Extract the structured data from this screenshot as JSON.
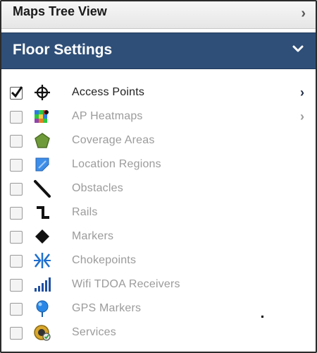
{
  "maps_tree": {
    "title": "Maps Tree View",
    "chevron": "›"
  },
  "floor_settings": {
    "title": "Floor Settings"
  },
  "layers": [
    {
      "label": "Access Points",
      "checked": true,
      "icon": "access-point-icon",
      "has_submenu": true,
      "submenu_active": true
    },
    {
      "label": "AP Heatmaps",
      "checked": false,
      "icon": "heatmap-icon",
      "has_submenu": true,
      "submenu_active": false
    },
    {
      "label": "Coverage Areas",
      "checked": false,
      "icon": "coverage-area-icon",
      "has_submenu": false
    },
    {
      "label": "Location Regions",
      "checked": false,
      "icon": "location-region-icon",
      "has_submenu": false
    },
    {
      "label": "Obstacles",
      "checked": false,
      "icon": "obstacle-icon",
      "has_submenu": false
    },
    {
      "label": "Rails",
      "checked": false,
      "icon": "rail-icon",
      "has_submenu": false
    },
    {
      "label": "Markers",
      "checked": false,
      "icon": "marker-icon",
      "has_submenu": false
    },
    {
      "label": "Chokepoints",
      "checked": false,
      "icon": "chokepoint-icon",
      "has_submenu": false
    },
    {
      "label": "Wifi TDOA Receivers",
      "checked": false,
      "icon": "signal-bars-icon",
      "has_submenu": false
    },
    {
      "label": "GPS Markers",
      "checked": false,
      "icon": "gps-pin-icon",
      "has_submenu": false
    },
    {
      "label": "Services",
      "checked": false,
      "icon": "services-icon",
      "has_submenu": false
    }
  ],
  "colors": {
    "header_blue": "#2f4f78",
    "active_text": "#1e1e1e",
    "inactive_text": "#9b9b9b"
  }
}
